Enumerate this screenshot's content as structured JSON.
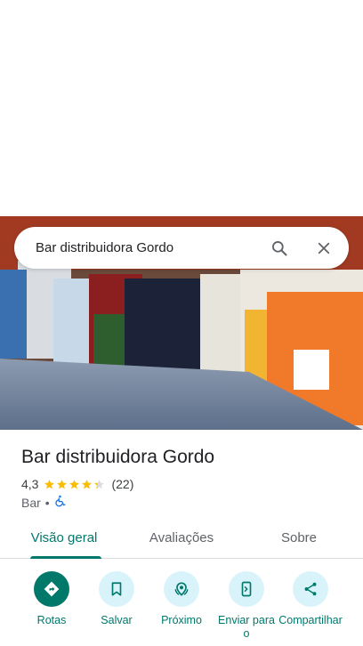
{
  "search": {
    "query": "Bar distribuidora Gordo"
  },
  "place": {
    "name": "Bar distribuidora Gordo",
    "rating": "4,3",
    "stars_value": 4.3,
    "review_count": "(22)",
    "category": "Bar",
    "separator": "•"
  },
  "tabs": [
    {
      "label": "Visão geral",
      "active": true
    },
    {
      "label": "Avaliações",
      "active": false
    },
    {
      "label": "Sobre",
      "active": false
    }
  ],
  "actions": [
    {
      "label": "Rotas",
      "icon": "directions-icon"
    },
    {
      "label": "Salvar",
      "icon": "bookmark-icon"
    },
    {
      "label": "Próximo",
      "icon": "nearby-icon"
    },
    {
      "label": "Enviar para o",
      "icon": "send-to-phone-icon"
    },
    {
      "label": "Compartilhar",
      "icon": "share-icon"
    }
  ],
  "colors": {
    "accent": "#00796b",
    "star": "#fbbc04",
    "action_bg": "#d9f3fb"
  }
}
